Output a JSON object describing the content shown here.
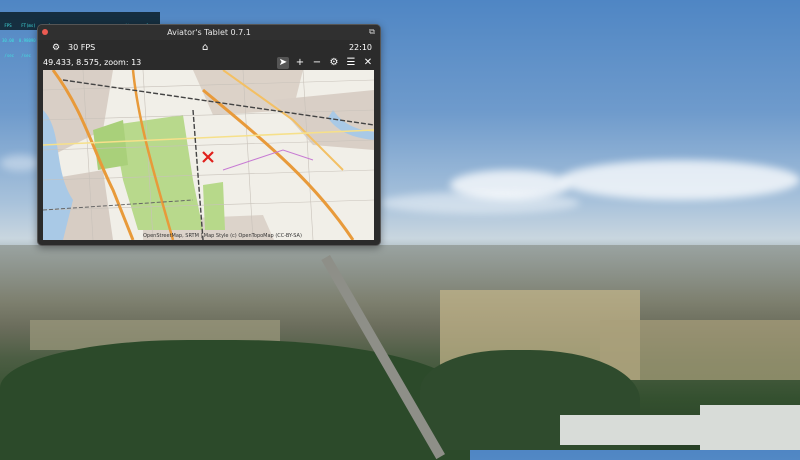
{
  "debug": {
    "lines": [
      " FPS    FT(ms)     frame      cpu      gpu       wait     xplane",
      "30.00  0.98090     0.0333   0.0134   0.0172   1.0000    0.0000",
      " /sec   /sec       time     time     time      time      time"
    ]
  },
  "window": {
    "title": "Aviator's Tablet  0.7.1",
    "fps_text": "30 FPS",
    "clock": "22:10",
    "coords_text": "49.433, 8.575, zoom: 13",
    "attribution": "OpenStreetMap, SRTM | Map Style (c) OpenTopoMap (CC-BY-SA)"
  },
  "icons": {
    "settings": "gear-icon",
    "home": "home-icon",
    "follow": "navigation-arrow-icon",
    "zoom_in": "plus-icon",
    "zoom_out": "minus-icon",
    "map_settings": "gear-icon",
    "layers": "list-icon",
    "close": "close-icon",
    "aircraft": "aircraft-marker-icon"
  }
}
